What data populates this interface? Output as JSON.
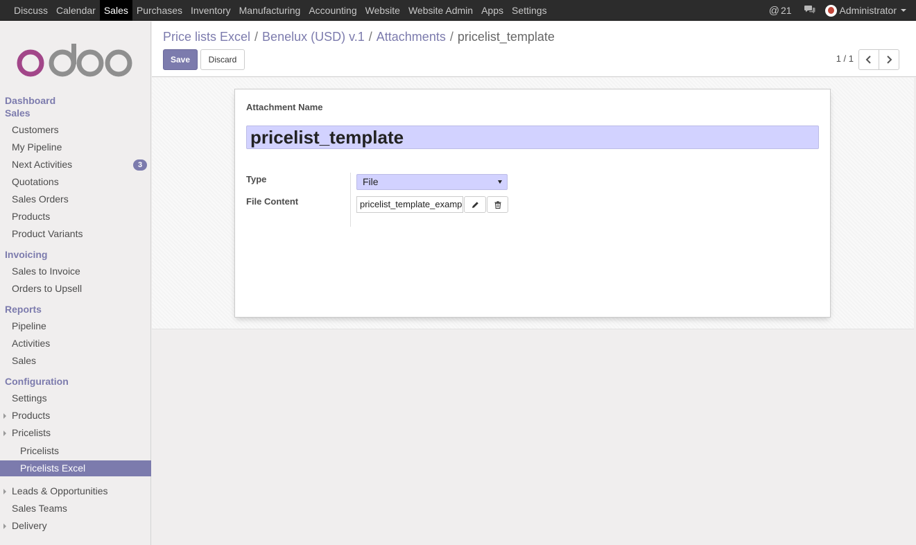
{
  "topbar": {
    "menu": [
      "Discuss",
      "Calendar",
      "Sales",
      "Purchases",
      "Inventory",
      "Manufacturing",
      "Accounting",
      "Website",
      "Website Admin",
      "Apps",
      "Settings"
    ],
    "active_menu": "Sales",
    "messages_count": "21",
    "user": "Administrator"
  },
  "sidebar": {
    "logo_text": "odoo",
    "sections": {
      "dashboard": "Dashboard",
      "sales": "Sales",
      "invoicing": "Invoicing",
      "reports": "Reports",
      "configuration": "Configuration"
    },
    "items": {
      "customers": "Customers",
      "my_pipeline": "My Pipeline",
      "next_activities": "Next Activities",
      "next_activities_badge": "3",
      "quotations": "Quotations",
      "sales_orders": "Sales Orders",
      "products": "Products",
      "product_variants": "Product Variants",
      "sales_to_invoice": "Sales to Invoice",
      "orders_to_upsell": "Orders to Upsell",
      "pipeline": "Pipeline",
      "activities": "Activities",
      "sales_report": "Sales",
      "settings": "Settings",
      "config_products": "Products",
      "pricelists": "Pricelists",
      "pricelists_sub": "Pricelists",
      "pricelists_excel": "Pricelists Excel",
      "leads_opportunities": "Leads & Opportunities",
      "sales_teams": "Sales Teams",
      "delivery": "Delivery"
    }
  },
  "breadcrumb": {
    "items": [
      "Price lists Excel",
      "Benelux (USD) v.1",
      "Attachments"
    ],
    "separator": "/",
    "current": "pricelist_template"
  },
  "actions": {
    "save": "Save",
    "discard": "Discard"
  },
  "pager": {
    "value": "1 / 1"
  },
  "form": {
    "name_label": "Attachment Name",
    "name_value": "pricelist_template",
    "type_label": "Type",
    "type_value": "File",
    "content_label": "File Content",
    "content_value": "pricelist_template_example.xlsx"
  },
  "colors": {
    "brand": "#7c7bad",
    "topbar": "#2c2c2c",
    "required_field": "#d2d2ff"
  }
}
